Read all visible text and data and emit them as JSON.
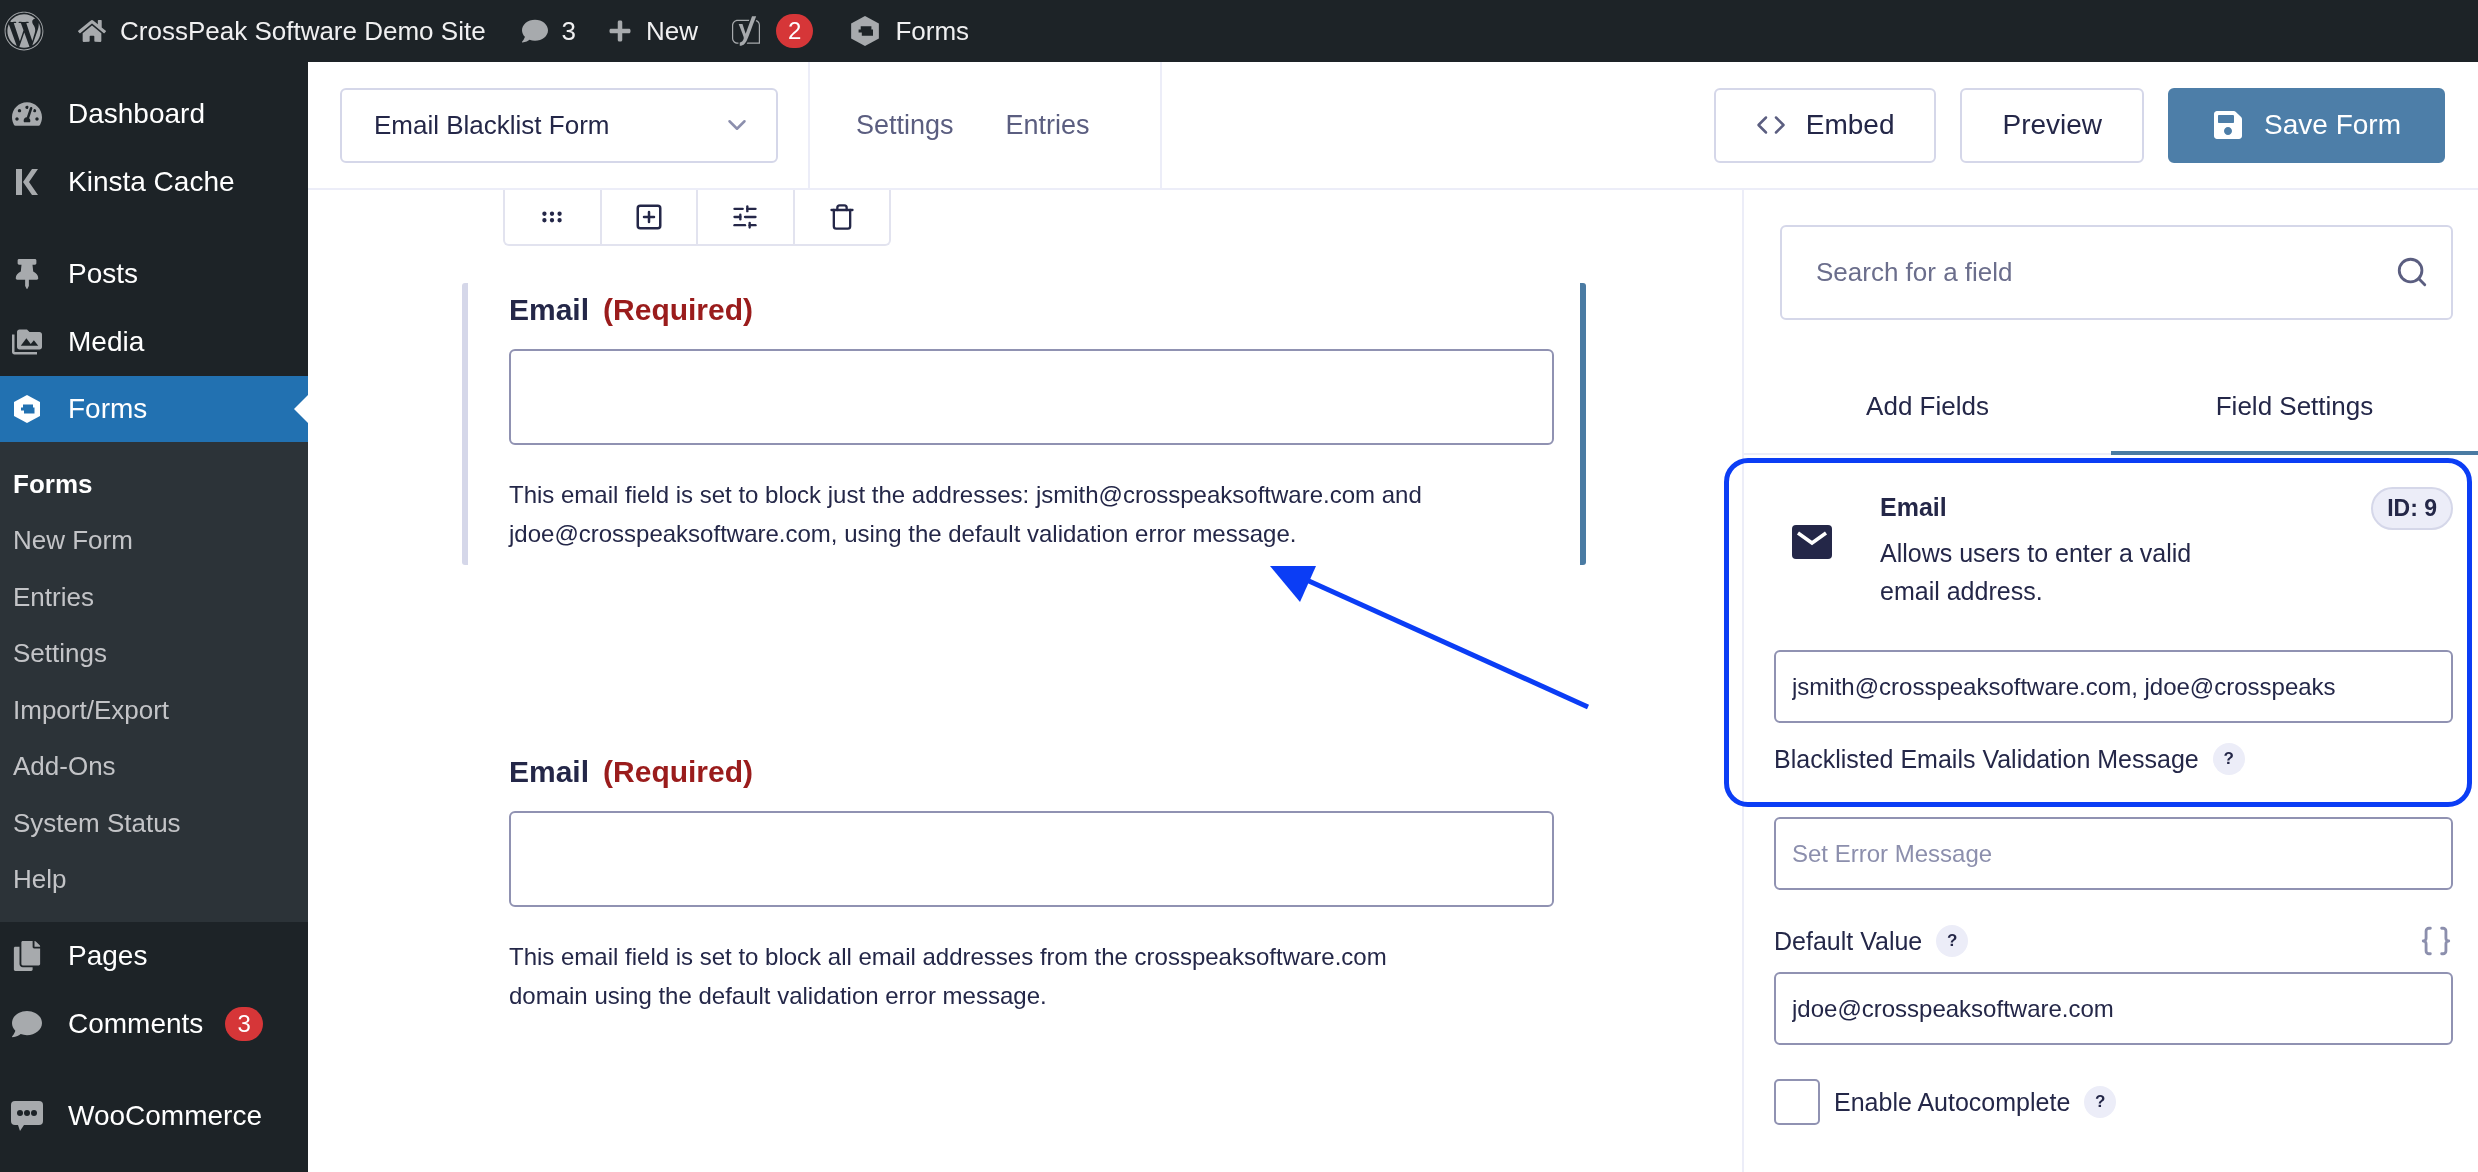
{
  "admin_bar": {
    "site_name": "CrossPeak Software Demo Site",
    "comments_count": "3",
    "new_label": "New",
    "seo_badge": "2",
    "forms_label": "Forms"
  },
  "sidebar": {
    "groups": [
      [
        {
          "label": "Dashboard",
          "selected": false
        },
        {
          "label": "Kinsta Cache",
          "selected": false
        }
      ],
      [
        {
          "label": "Posts",
          "selected": false
        },
        {
          "label": "Media",
          "selected": false
        },
        {
          "label": "Forms",
          "selected": true,
          "children": [
            {
              "label": "Forms",
              "selected": true
            },
            {
              "label": "New Form",
              "selected": false
            },
            {
              "label": "Entries",
              "selected": false
            },
            {
              "label": "Settings",
              "selected": false
            },
            {
              "label": "Import/Export",
              "selected": false
            },
            {
              "label": "Add-Ons",
              "selected": false
            },
            {
              "label": "System Status",
              "selected": false
            },
            {
              "label": "Help",
              "selected": false
            }
          ]
        },
        {
          "label": "Pages",
          "selected": false
        },
        {
          "label": "Comments",
          "selected": false,
          "badge": "3"
        }
      ],
      [
        {
          "label": "WooCommerce",
          "selected": false
        }
      ]
    ]
  },
  "header": {
    "form_select": {
      "value": "Email Blacklist Form"
    },
    "links": [
      {
        "label": "Settings"
      },
      {
        "label": "Entries"
      }
    ],
    "buttons": [
      {
        "label": "Embed",
        "kind": "code"
      },
      {
        "label": "Preview",
        "kind": "plain"
      },
      {
        "label": "Save Form",
        "kind": "primary"
      }
    ]
  },
  "fields": [
    {
      "label": "Email",
      "required_text": "(Required)",
      "selected": true,
      "description": "This email field is set to block just the addresses: jsmith@crosspeaksoftware.com and jdoe@crosspeaksoftware.com, using the default validation error message."
    },
    {
      "label": "Email",
      "required_text": "(Required)",
      "selected": false,
      "description": "This email field is set to block all email addresses from the crosspeaksoftware.com domain using the default validation error message."
    }
  ],
  "panel": {
    "search": {
      "placeholder": "Search for a field"
    },
    "tabs": [
      {
        "label": "Add Fields",
        "selected": false
      },
      {
        "label": "Field Settings",
        "selected": true
      }
    ],
    "field_info": {
      "title": "Email",
      "description": "Allows users to enter a valid email address.",
      "id_badge": "ID: 9"
    },
    "blacklist": {
      "value": "jsmith@crosspeaksoftware.com, jdoe@crosspeaks"
    },
    "validation_message": {
      "label": "Blacklisted Emails Validation Message",
      "help": "?",
      "placeholder": "Set Error Message"
    },
    "default_value": {
      "label": "Default Value",
      "help": "?",
      "value": "jdoe@crosspeaksoftware.com"
    },
    "autocomplete": {
      "label": "Enable Autocomplete",
      "help": "?",
      "checked": false
    }
  }
}
